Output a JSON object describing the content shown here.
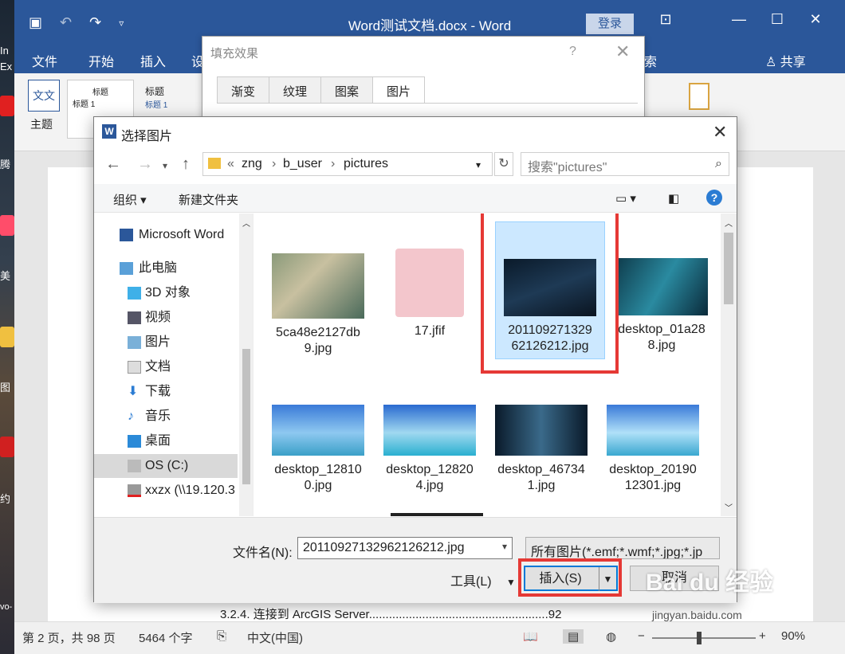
{
  "desktop": {
    "labels": [
      "In",
      "Ex",
      "腾",
      "美",
      "图",
      "约",
      "vo-"
    ]
  },
  "word": {
    "title": "Word测试文档.docx  -  Word",
    "login": "登录",
    "share": "共享",
    "tabs": [
      "文件",
      "开始",
      "插入",
      "设",
      "索"
    ],
    "theme_label": "主题",
    "theme_icon_text": "文文",
    "style1_title": "标题",
    "style1_sub": "标题 1",
    "style2_title": "标题",
    "style2_sub": "标题 1",
    "toc_line": "3.2.4.  连接到 ArcGIS Server......................................................92",
    "status": {
      "page": "第 2 页，共 98 页",
      "words": "5464 个字",
      "lang": "中文(中国)",
      "zoom": "90%"
    }
  },
  "fill_dialog": {
    "title": "填充效果",
    "help": "?",
    "tabs": [
      "渐变",
      "纹理",
      "图案",
      "图片"
    ],
    "active_tab": "图片"
  },
  "file_dialog": {
    "title": "选择图片",
    "path": [
      "zng",
      "b_user",
      "pictures"
    ],
    "path_prefix": "«",
    "search_placeholder": "搜索\"pictures\"",
    "toolbar": {
      "organize": "组织 ▾",
      "new_folder": "新建文件夹"
    },
    "nav": [
      {
        "label": "Microsoft Word",
        "icon": "word-icon"
      },
      {
        "label": "此电脑",
        "icon": "computer-icon"
      },
      {
        "label": "3D 对象",
        "icon": "3d-objects-icon"
      },
      {
        "label": "视频",
        "icon": "video-icon"
      },
      {
        "label": "图片",
        "icon": "pictures-icon"
      },
      {
        "label": "文档",
        "icon": "documents-icon"
      },
      {
        "label": "下载",
        "icon": "download-icon"
      },
      {
        "label": "音乐",
        "icon": "music-icon"
      },
      {
        "label": "桌面",
        "icon": "desktop-icon"
      },
      {
        "label": "OS (C:)",
        "icon": "drive-icon"
      },
      {
        "label": "xxzx (\\\\19.120.3",
        "icon": "network-drive-icon"
      }
    ],
    "selected_nav": "OS (C:)",
    "files": [
      {
        "name1": "5ca48e2127db",
        "name2": "9.jpg"
      },
      {
        "name1": "17.jfif",
        "name2": ""
      },
      {
        "name1": "201109271329",
        "name2": "62126212.jpg"
      },
      {
        "name1": "desktop_01a28",
        "name2": "8.jpg"
      },
      {
        "name1": "desktop_12810",
        "name2": "0.jpg"
      },
      {
        "name1": "desktop_12820",
        "name2": "4.jpg"
      },
      {
        "name1": "desktop_46734",
        "name2": "1.jpg"
      },
      {
        "name1": "desktop_20190",
        "name2": "12301.jpg"
      }
    ],
    "selected_file": "20110927132962126212.jpg",
    "filename_label": "文件名(N):",
    "filename_value": "20110927132962126212.jpg",
    "file_type": "所有图片(*.emf;*.wmf;*.jpg;*.jp",
    "tools": "工具(L)",
    "insert": "插入(S)",
    "cancel": "取消"
  },
  "watermark": {
    "brand": "Bai du 经验",
    "url": "jingyan.baidu.com"
  },
  "colors": {
    "word_blue": "#2b579a",
    "highlight_red": "#e53935",
    "selection_blue": "#cce8ff"
  }
}
